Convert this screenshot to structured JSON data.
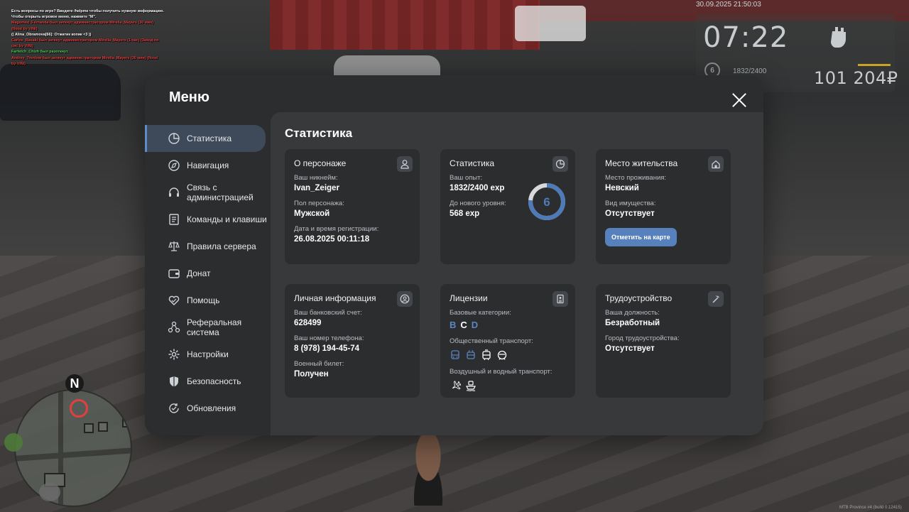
{
  "hud": {
    "datetime": "30.09.2025 21:50:03",
    "clock": "07:22",
    "level": "6",
    "exp": "1832/2400",
    "money": "101 204₽"
  },
  "chat": [
    {
      "text": "Есть вопросы по игре? Введите /helpme чтобы получить нужную информацию.",
      "color": "#ffffff"
    },
    {
      "text": "Чтобы открыть игровое меню, нажмите \"M\".",
      "color": "#ffffff"
    },
    {
      "text": "Magomed_Fernanda был заткнут администратором Mirella_Mayers (30 мин)",
      "color": "#e84040"
    },
    {
      "text": "(flood by ViNi)",
      "color": "#e84040"
    },
    {
      "text": "(( Alina_Obramova[66]: Отжатик копик <3 ))",
      "color": "#ffffff"
    },
    {
      "text": "Carlos_Rasaki был заткнут администратором Mirella_Mayers (1 час) (Заход по",
      "color": "#e84040"
    },
    {
      "text": "сис by ViNi)",
      "color": "#e84040"
    },
    {
      "text": "Farfetch_Chizh был разоткнут.",
      "color": "#4fd05a"
    },
    {
      "text": "Andrey_Trenlow был заткнут администратором Mirella_Mayers (30 мин) (flood",
      "color": "#e84040"
    },
    {
      "text": " by ViNi)",
      "color": "#e84040"
    }
  ],
  "minimap": {
    "north": "N"
  },
  "build_info": "MTB Province #4 (build 0.12415)",
  "menu": {
    "title": "Меню",
    "nav": [
      {
        "label": "Статистика",
        "icon": "pie-chart-icon",
        "active": true
      },
      {
        "label": "Навигация",
        "icon": "compass-icon"
      },
      {
        "label": "Связь с администрацией",
        "icon": "headset-icon"
      },
      {
        "label": "Команды и клавиши",
        "icon": "document-icon"
      },
      {
        "label": "Правила сервера",
        "icon": "scales-icon"
      },
      {
        "label": "Донат",
        "icon": "wallet-icon"
      },
      {
        "label": "Помощь",
        "icon": "heart-hands-icon"
      },
      {
        "label": "Реферальная система",
        "icon": "network-icon"
      },
      {
        "label": "Настройки",
        "icon": "gear-icon"
      },
      {
        "label": "Безопасность",
        "icon": "shield-icon"
      },
      {
        "label": "Обновления",
        "icon": "refresh-check-icon"
      }
    ]
  },
  "stats": {
    "title": "Статистика",
    "character": {
      "title": "О персонаже",
      "nick_label": "Ваш никнейм:",
      "nick": "Ivan_Zeiger",
      "gender_label": "Пол персонажа:",
      "gender": "Мужской",
      "reg_label": "Дата и время регистрации:",
      "reg": "26.08.2025 00:11:18"
    },
    "statistics": {
      "title": "Статистика",
      "exp_label": "Ваш опыт:",
      "exp": "1832/2400 exp",
      "next_label": "До нового уровня:",
      "next": "568 exp",
      "level": "6",
      "progress": 0.7633
    },
    "residence": {
      "title": "Место жительства",
      "place_label": "Место проживания:",
      "place": "Невский",
      "property_label": "Вид имущества:",
      "property": "Отсутствует",
      "button": "Отметить на карте"
    },
    "personal": {
      "title": "Личная информация",
      "bank_label": "Ваш банковский счет:",
      "bank": "628499",
      "phone_label": "Ваш номер телефона:",
      "phone": "8 (978) 194-45-74",
      "military_label": "Военный билет:",
      "military": "Получен"
    },
    "licenses": {
      "title": "Лицензии",
      "base_label": "Базовые категории:",
      "categories": [
        {
          "letter": "B",
          "color": "#5b86c2"
        },
        {
          "letter": "C",
          "color": "#ffffff"
        },
        {
          "letter": "D",
          "color": "#5b86c2"
        }
      ],
      "public_label": "Общественный транспорт:",
      "air_label": "Воздушный и водный транспорт:"
    },
    "employment": {
      "title": "Трудоустройство",
      "position_label": "Ваша должность:",
      "position": "Безработный",
      "city_label": "Город трудоустройства:",
      "city": "Отсутствует"
    }
  }
}
